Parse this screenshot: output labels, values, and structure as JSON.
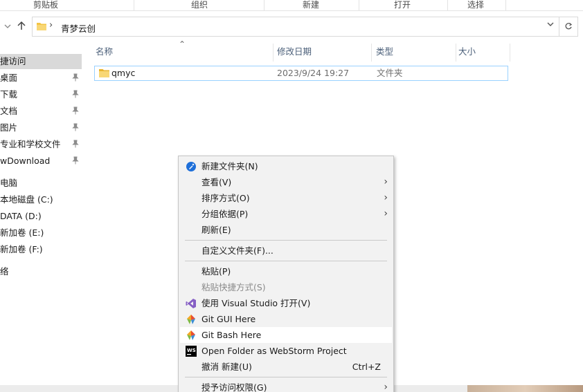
{
  "ribbon": {
    "groups": [
      "剪贴板",
      "组织",
      "新建",
      "打开",
      "选择"
    ]
  },
  "address": {
    "path": "青梦云创",
    "back_icon": "chevron-down-icon",
    "up_icon": "arrow-up-icon",
    "refresh_icon": "refresh-icon"
  },
  "sidebar": {
    "items": [
      {
        "label": "捷访问",
        "pinned": false
      },
      {
        "label": "桌面",
        "pinned": true
      },
      {
        "label": "下载",
        "pinned": true
      },
      {
        "label": "文档",
        "pinned": true
      },
      {
        "label": "图片",
        "pinned": true
      },
      {
        "label": "专业和学校文件",
        "pinned": true
      },
      {
        "label": "wDownload",
        "pinned": true
      },
      {
        "label": "电脑",
        "pinned": false
      },
      {
        "label": "本地磁盘 (C:)",
        "pinned": false
      },
      {
        "label": "DATA (D:)",
        "pinned": false
      },
      {
        "label": "新加卷 (E:)",
        "pinned": false
      },
      {
        "label": "新加卷 (F:)",
        "pinned": false
      },
      {
        "label": "络",
        "pinned": false
      }
    ]
  },
  "list": {
    "columns": [
      "名称",
      "修改日期",
      "类型",
      "大小"
    ],
    "rows": [
      {
        "name": "qmyc",
        "modified": "2023/9/24 19:27",
        "type": "文件夹",
        "size": ""
      }
    ]
  },
  "context_menu": {
    "items": [
      {
        "label": "新建文件夹(N)",
        "icon": "new-folder-icon"
      },
      {
        "label": "查看(V)",
        "submenu": true
      },
      {
        "label": "排序方式(O)",
        "submenu": true
      },
      {
        "label": "分组依据(P)",
        "submenu": true
      },
      {
        "label": "刷新(E)"
      },
      {
        "label": "自定义文件夹(F)..."
      },
      {
        "label": "粘贴(P)"
      },
      {
        "label": "粘贴快捷方式(S)",
        "disabled": true
      },
      {
        "label": "使用 Visual Studio 打开(V)",
        "icon": "visual-studio-icon"
      },
      {
        "label": "Git GUI Here",
        "icon": "git-gui-icon"
      },
      {
        "label": "Git Bash Here",
        "icon": "git-bash-icon",
        "hover": true
      },
      {
        "label": "Open Folder as WebStorm Project",
        "icon": "webstorm-icon"
      },
      {
        "label": "撤消 新建(U)",
        "shortcut": "Ctrl+Z"
      },
      {
        "label": "授予访问权限(G)",
        "submenu": true
      }
    ]
  },
  "colors": {
    "folder": "#f3c443",
    "selection_border": "#99d1ff",
    "menu_bg": "#f2f2f2",
    "header_text": "#4c607a",
    "vs_purple": "#865fc5",
    "new_folder_blue": "#1e6fd9"
  }
}
